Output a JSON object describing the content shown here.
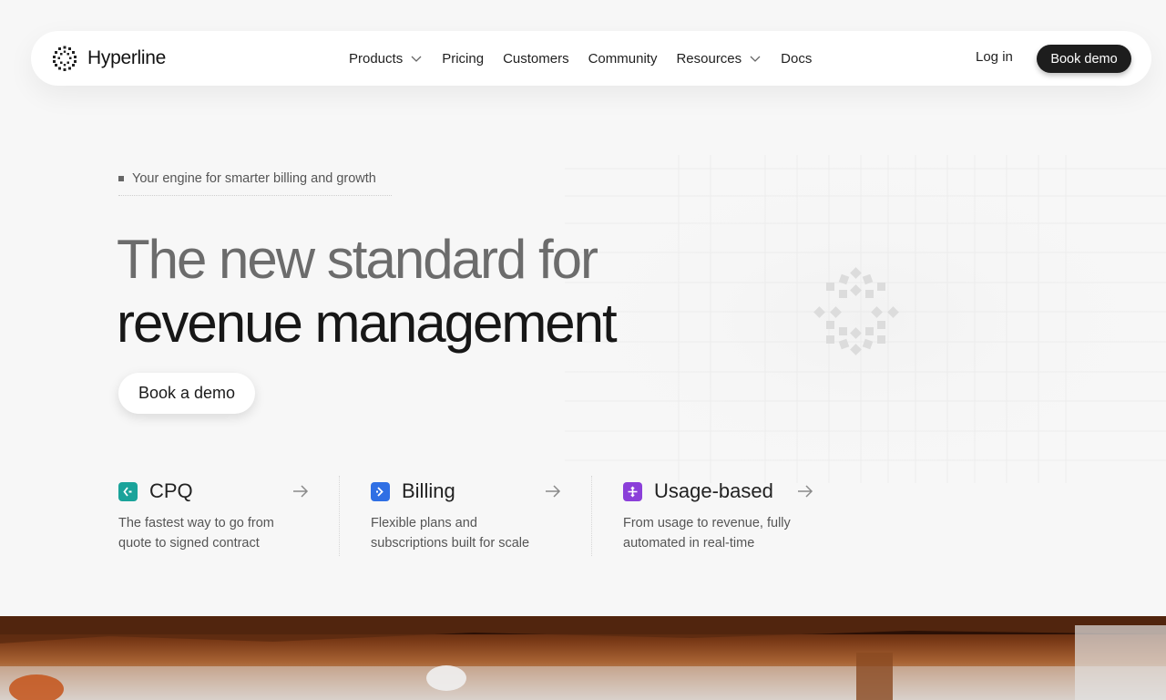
{
  "brand": {
    "name": "Hyperline"
  },
  "nav": {
    "items": [
      {
        "label": "Products",
        "has_dropdown": true
      },
      {
        "label": "Pricing",
        "has_dropdown": false
      },
      {
        "label": "Customers",
        "has_dropdown": false
      },
      {
        "label": "Community",
        "has_dropdown": false
      },
      {
        "label": "Resources",
        "has_dropdown": true
      },
      {
        "label": "Docs",
        "has_dropdown": false
      }
    ],
    "login_label": "Log in",
    "book_demo_label": "Book demo"
  },
  "hero": {
    "eyebrow": "Your engine for smarter billing and growth",
    "headline_line1": "The new standard for",
    "headline_line2": "revenue management",
    "cta_label": "Book a demo"
  },
  "features": [
    {
      "title": "CPQ",
      "description": "The fastest way to go from quote to signed contract",
      "icon": "cpq-icon",
      "color": "#1aa39a"
    },
    {
      "title": "Billing",
      "description": "Flexible plans and subscriptions built for scale",
      "icon": "billing-icon",
      "color": "#2f6fe4"
    },
    {
      "title": "Usage-based",
      "description": "From usage to revenue, fully automated in real-time",
      "icon": "usage-icon",
      "color": "#8b3fd9"
    }
  ],
  "colors": {
    "background": "#f7f7f7",
    "primary_button": "#1d1d1d",
    "headline_muted": "#6c6c6c",
    "headline_dark": "#171717"
  }
}
